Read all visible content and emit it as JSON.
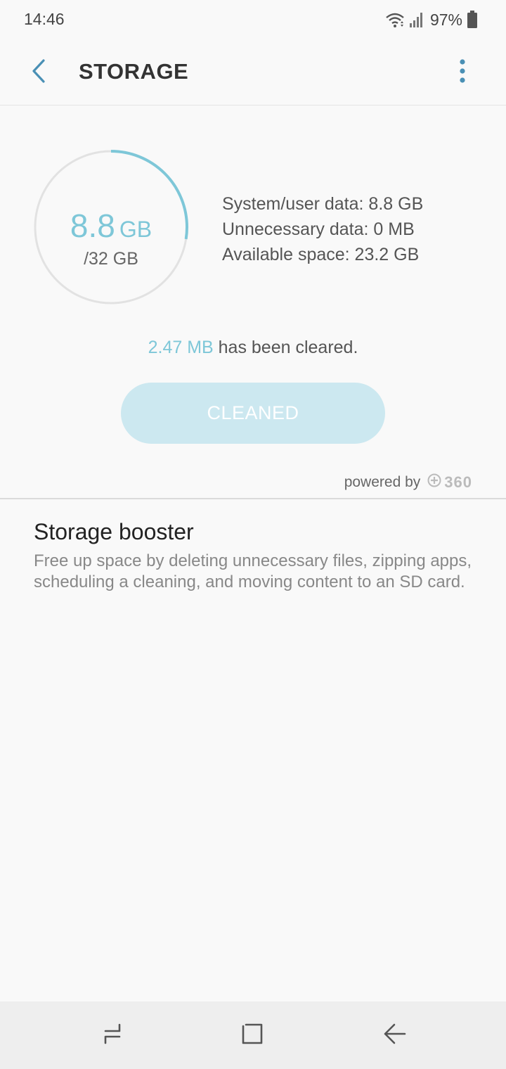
{
  "status_bar": {
    "time": "14:46",
    "battery_percent": "97%",
    "icons": [
      "wifi-icon",
      "signal-icon",
      "battery-icon"
    ]
  },
  "app_bar": {
    "title": "STORAGE",
    "icons": [
      "back-arrow-icon",
      "more-vert-icon"
    ]
  },
  "usage": {
    "used_value": "8.8",
    "used_unit": "GB",
    "total": "/32 GB",
    "used_fraction": 0.275,
    "ring_color": "#7ec7d8",
    "track_color": "#e2e2e2"
  },
  "details": [
    "System/user data: 8.8 GB",
    "Unnecessary data: 0 MB",
    "Available space: 23.2 GB"
  ],
  "cleared": {
    "amount": "2.47 MB",
    "suffix": " has been cleared."
  },
  "clean_button": {
    "label": "CLEANED",
    "color": "#cce8f0"
  },
  "powered_by": {
    "label": "powered by",
    "brand": "360",
    "icon": "plus-circle-icon"
  },
  "booster": {
    "title": "Storage booster",
    "description": "Free up space by deleting unnecessary files, zipping apps, scheduling a cleaning, and moving content to an SD card."
  },
  "nav_bar": {
    "icons": [
      "recent-apps-icon",
      "home-icon",
      "back-icon"
    ]
  },
  "colors": {
    "accent": "#4a90b5",
    "highlight": "#7ec7d8"
  }
}
